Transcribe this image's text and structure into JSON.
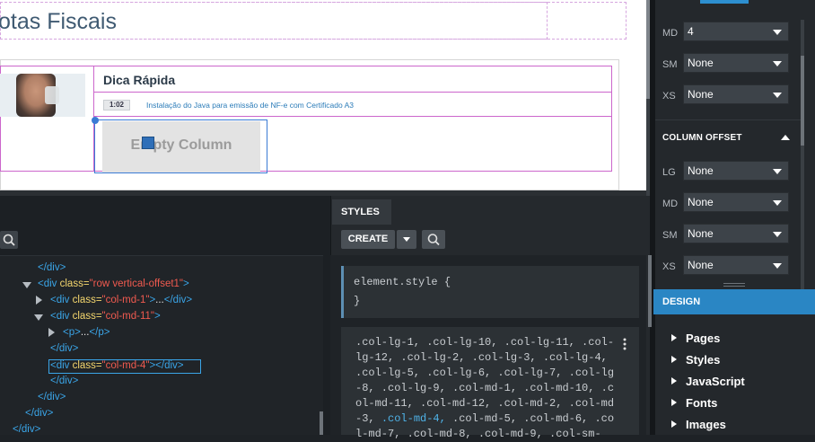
{
  "preview": {
    "page_title": "otas Fiscais",
    "tip_title": "Dica Rápida",
    "duration": "1:02",
    "video_link": "Instalação do Java para emissão de NF-e com Certificado A3",
    "empty_column": "Empty Column"
  },
  "right_panel": {
    "rows_top": [
      {
        "label": "MD",
        "value": "4"
      },
      {
        "label": "SM",
        "value": "None"
      },
      {
        "label": "XS",
        "value": "None"
      }
    ],
    "column_offset_title": "COLUMN OFFSET",
    "rows_offset": [
      {
        "label": "LG",
        "value": "None"
      },
      {
        "label": "MD",
        "value": "None"
      },
      {
        "label": "SM",
        "value": "None"
      },
      {
        "label": "XS",
        "value": "None"
      }
    ],
    "design_title": "DESIGN",
    "design_items": [
      "Pages",
      "Styles",
      "JavaScript",
      "Fonts",
      "Images"
    ]
  },
  "html_panel": {
    "lines": {
      "l1": "</div>",
      "l2_tag": "<div ",
      "l2_attr": "class=",
      "l2_val": "\"row vertical-offset1\"",
      "l2_end": ">",
      "l3_tag": "<div ",
      "l3_attr": "class=",
      "l3_val": "\"col-md-1\"",
      "l3_mid": ">",
      "l3_dots": "...",
      "l3_close": "</div>",
      "l4_tag": "<div ",
      "l4_attr": "class=",
      "l4_val": "\"col-md-11\"",
      "l4_end": ">",
      "l5_tag": "<p>",
      "l5_dots": "...",
      "l5_close": "</p>",
      "l6": "</div>",
      "l7_tag": "<div ",
      "l7_attr": "class=",
      "l7_val": "\"col-md-4\"",
      "l7_end": "></div>",
      "l8": "</div>",
      "l9": "</div>",
      "l10": "</div>",
      "l11": "</div>"
    }
  },
  "styles_panel": {
    "tab": "STYLES",
    "create_label": "CREATE",
    "rule1_selector": "element.style {",
    "rule1_close": "}",
    "rule2_before": ".col-lg-1, .col-lg-10, .col-lg-11, .col-lg-12, .col-lg-2, .col-lg-3, .col-lg-4, .col-lg-5, .col-lg-6, .col-lg-7, .col-lg-8, .col-lg-9, .col-md-1, .col-md-10, .col-md-11, .col-md-12, .col-md-2, .col-md-3, ",
    "rule2_highlight": ".col-md-4,",
    "rule2_after": " .col-md-5, .col-md-6, .col-md-7, .col-md-8, .col-md-9, .col-sm-"
  },
  "colors": {
    "accent": "#2a86c4",
    "tag": "#3aa5e8",
    "attr": "#f5d76e",
    "value": "#f05a4f"
  }
}
